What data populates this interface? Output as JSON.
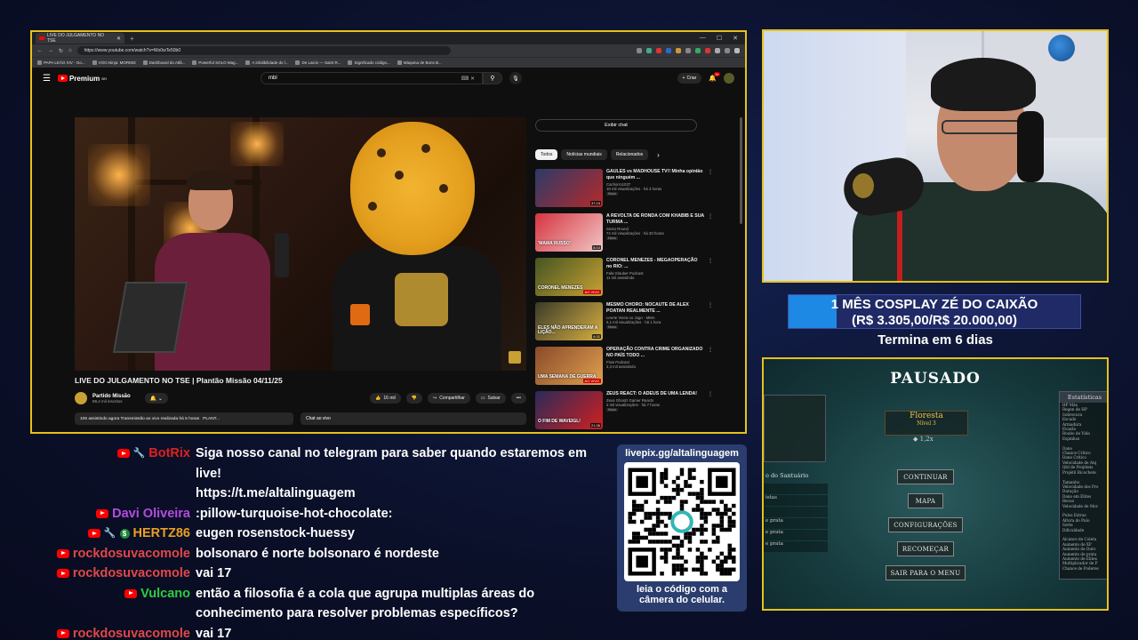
{
  "browser": {
    "tab_title": "LIVE DO JULGAMENTO NO TSE",
    "url": "https://www.youtube.com/watch?v=Wo0wTe50b0",
    "bookmarks": [
      "PAPA LEÃO XIV - Go...",
      "VOO.Ninja: MORIM3",
      "Dashboard do Atlâ...",
      "Powerful SOLO Mag...",
      "A infalibilidade do l...",
      "De Laicis — Saint R...",
      "Significado código...",
      "Máquina de Bons B..."
    ]
  },
  "youtube": {
    "logo": "Premium",
    "logo_sup": "BR",
    "search_value": "mbl",
    "create_label": "Criar",
    "notif_count": "9+",
    "video_title": "LIVE DO JULGAMENTO NO TSE | Plantão Missão 04/11/25",
    "channel_name": "Partido Missão",
    "channel_subs": "59,4 mil inscritos",
    "likes": "16 mil",
    "share": "Compartilhar",
    "save": "Salvar",
    "live_info": "106 assistindo agora  Transmissão ao vivo realizada há 5 horas",
    "live_tags": "PLANT...",
    "chat_label": "Chat ao vivo",
    "show_chat": "Exibir chat",
    "chips": [
      "Todos",
      "Notícias mundiais",
      "Relacionados"
    ],
    "recs": [
      {
        "title": "GAULES vs MADHOUSE TV!! Minha opinião que ninguém ...",
        "channel": "Cachorro1037",
        "meta": "18 mil visualizações · há 3 horas",
        "badge": "Novo",
        "dur": "37:15",
        "c1": "#2c3a6a",
        "c2": "#b52a2a"
      },
      {
        "title": "A REVOLTA DE RONDA COM KHABIB E SUA TURMA ...",
        "channel": "Sexto Round",
        "meta": "74 mil visualizações · há 20 horas",
        "badge": "Novo",
        "dur": "8:10",
        "c1": "#d7343f",
        "c2": "#f0c6c6",
        "thumb_text": "'MAMA RUSSO'"
      },
      {
        "title": "CORONEL MENEZES - MEGAOPERAÇÃO no RIO: ...",
        "channel": "Fala Glauber Podcast",
        "meta": "11 mil assistindo",
        "badge": "",
        "live": "AO VIVO",
        "c1": "#445522",
        "c2": "#c9a033",
        "thumb_text": "CORONEL MENEZES"
      },
      {
        "title": "MESMO CHORO: NOCAUTE DE ALEX POATAN REALMENTE ...",
        "channel": "Leerte Vieira no Jogo - MMA",
        "meta": "6,1 mil visualizações · há 1 hora",
        "badge": "Novo",
        "dur": "6:32",
        "c1": "#3a3a2a",
        "c2": "#d8b040",
        "thumb_text": "ELES NÃO APRENDERAM A LIÇÃO..."
      },
      {
        "title": "OPERAÇÃO CONTRA CRIME ORGANIZADO NO PAÍS TODO ...",
        "channel": "Flow Podcast",
        "meta": "2,3 mil assistindo",
        "badge": "",
        "live": "AO VIVO",
        "c1": "#8a4a2a",
        "c2": "#e0a050",
        "thumb_text": "UMA SEMANA DE GUERRA"
      },
      {
        "title": "ZEUS REACT: O ADEUS DE UMA LENDA!",
        "channel": "Zeus Ghostz Gamer Reacts",
        "meta": "2 mil visualizações · há 7 horas",
        "badge": "Novo",
        "dur": "21:36",
        "c1": "#2a2a5a",
        "c2": "#d02020",
        "thumb_text": "O FIM DE WAVEIGL!"
      }
    ]
  },
  "goal": {
    "line1": "1 MÊS COSPLAY ZÉ DO CAIXÃO",
    "line2": "(R$ 3.305,00/R$ 20.000,00)",
    "progress": 0.165,
    "ends": "Termina em 6 dias"
  },
  "game": {
    "title": "PAUSADO",
    "biome": "Floresta",
    "level": "Nível 3",
    "multiplier": "1,2x",
    "buttons": [
      "CONTINUAR",
      "MAPA",
      "CONFIGURAÇÕES",
      "RECOMEÇAR",
      "SAIR PARA O MENU"
    ],
    "left_title": "o do Santuário",
    "left_rows": [
      "",
      "istas",
      "",
      "e prata",
      "e prata",
      "e prata"
    ],
    "stats_title": "Estatísticas",
    "stats": [
      "HP Máx",
      "Regen de HP",
      "Sobrecura",
      "Escudo",
      "Armadura",
      "Evasão",
      "Roubo de Vida",
      "Espinhos",
      "",
      "Dano",
      "Chance Crítico",
      "Dano Crítico",
      "Velocidade de Atq",
      "Qtd de Projéteis",
      "Projétil Ricochete",
      "",
      "Tamanho",
      "Velocidade dos Pro",
      "Duração",
      "Dano em Elites",
      "Recuo",
      "Velocidade de Mov",
      "",
      "Pulos Extras",
      "Altura do Pulo",
      "Sorte",
      "Dificuldade",
      "",
      "Alcance de Coleta",
      "Aumento de XP",
      "Aumento de Ouro",
      "Aumento de prata",
      "Aumento de Elites",
      "Multiplicador de P",
      "Chance de Poderes"
    ]
  },
  "chat": [
    {
      "user": "BotRix",
      "color": "#e02020",
      "badges": [
        "yt",
        "wrench"
      ],
      "text": "Siga nosso canal no telegram para saber quando estaremos em live!"
    },
    {
      "user": "",
      "color": "#fff",
      "badges": [],
      "text": "https://t.me/altalinguagem"
    },
    {
      "user": "Davi Oliveira",
      "color": "#b44be0",
      "badges": [
        "yt"
      ],
      "text": ":pillow-turquoise-hot-chocolate:"
    },
    {
      "user": "HERTZ86",
      "color": "#e8a020",
      "badges": [
        "yt",
        "wrench",
        "dollar"
      ],
      "text": "eugen rosenstock-huessy"
    },
    {
      "user": "rockdosuvacomole",
      "color": "#e04848",
      "badges": [
        "yt"
      ],
      "text": "bolsonaro é norte bolsonaro é nordeste"
    },
    {
      "user": "rockdosuvacomole",
      "color": "#e04848",
      "badges": [
        "yt"
      ],
      "text": "vai 17"
    },
    {
      "user": "Vulcano",
      "color": "#2ecc40",
      "badges": [
        "yt"
      ],
      "text": "então a filosofia é a cola que agrupa multiplas áreas do"
    },
    {
      "user": "",
      "color": "#fff",
      "badges": [],
      "text": "conhecimento para resolver problemas específicos?"
    },
    {
      "user": "rockdosuvacomole",
      "color": "#e04848",
      "badges": [
        "yt"
      ],
      "text": "vai 17"
    }
  ],
  "qr": {
    "url": "livepix.gg/altalinguagem",
    "caption1": "leia o código com a",
    "caption2": "câmera do celular."
  }
}
